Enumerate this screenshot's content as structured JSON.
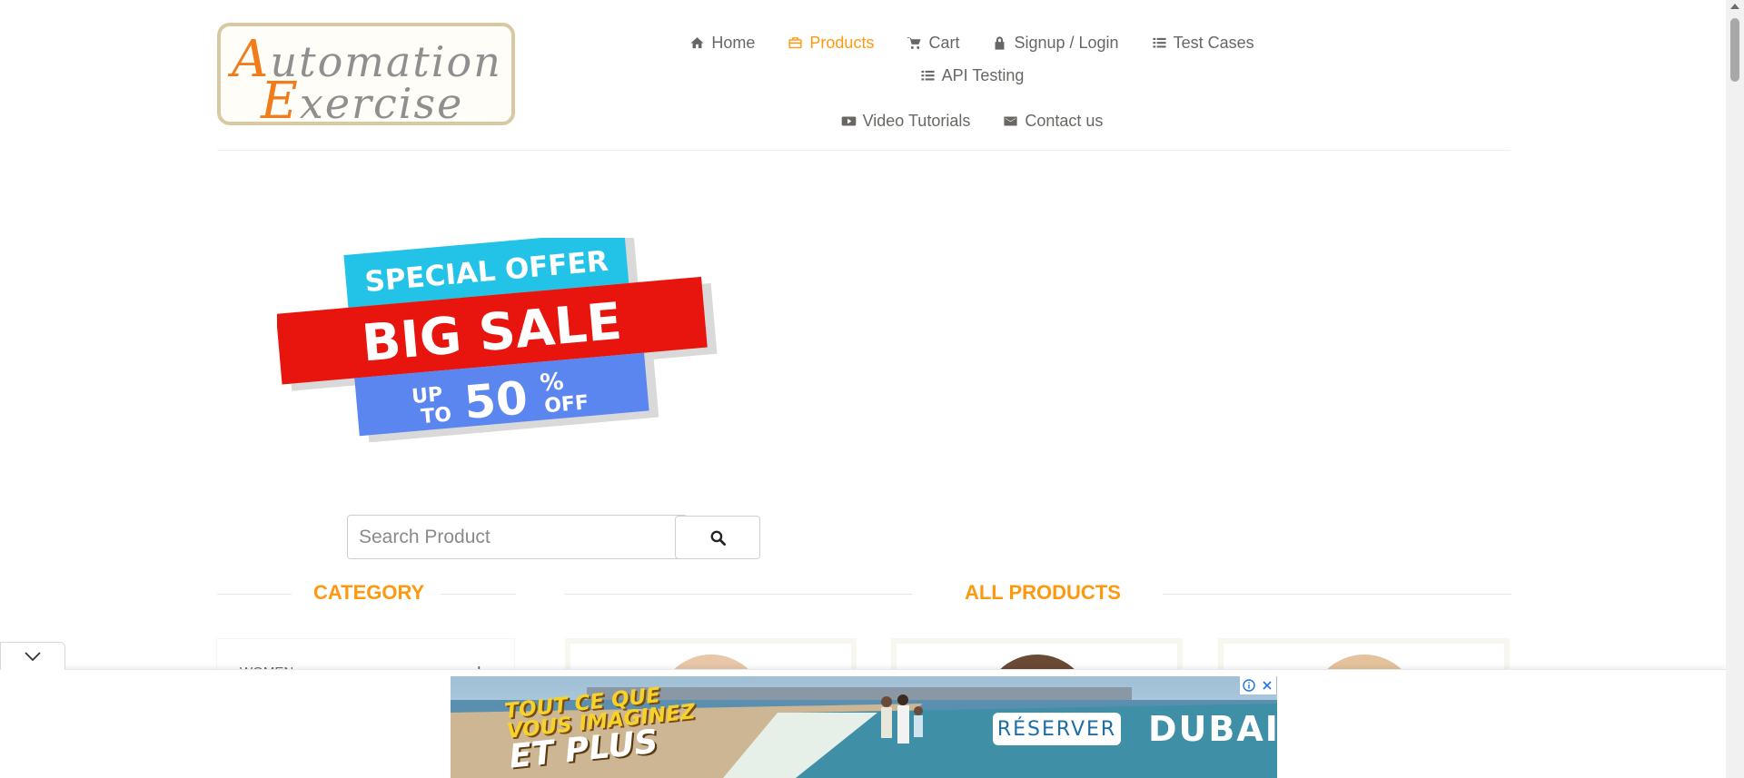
{
  "logo": {
    "line1_cap": "A",
    "line1_rest": "utomation",
    "line2_cap": "E",
    "line2_rest": "xercise"
  },
  "nav": {
    "items": [
      {
        "label": "Home",
        "icon": "home-icon"
      },
      {
        "label": "Products",
        "icon": "briefcase-icon",
        "active": true
      },
      {
        "label": "Cart",
        "icon": "cart-icon"
      },
      {
        "label": "Signup / Login",
        "icon": "lock-icon"
      },
      {
        "label": "Test Cases",
        "icon": "list-icon"
      },
      {
        "label": "API Testing",
        "icon": "list-icon"
      },
      {
        "label": "Video Tutorials",
        "icon": "youtube-icon"
      },
      {
        "label": "Contact us",
        "icon": "envelope-icon"
      }
    ]
  },
  "banner": {
    "line1": "SPECIAL OFFER",
    "line2": "BIG SALE",
    "up": "UP",
    "to": "TO",
    "percent": "50",
    "pct_sign": "%",
    "off": "OFF"
  },
  "search": {
    "placeholder": "Search Product",
    "value": ""
  },
  "sections": {
    "category_title": "CATEGORY",
    "products_title": "ALL PRODUCTS"
  },
  "category": {
    "first_item": "WOMEN",
    "expand_symbol": "+"
  },
  "ad": {
    "headline_line1": "TOUT CE QUE",
    "headline_line2": "VOUS IMAGINEZ",
    "headline_line3": "ET PLUS",
    "cta": "RÉSERVER",
    "brand": "DUBAI"
  },
  "colors": {
    "accent": "#fe980f",
    "text": "#696763",
    "banner_cyan": "#22c3e6",
    "banner_red": "#e8150e",
    "banner_blue": "#5b86f0"
  }
}
